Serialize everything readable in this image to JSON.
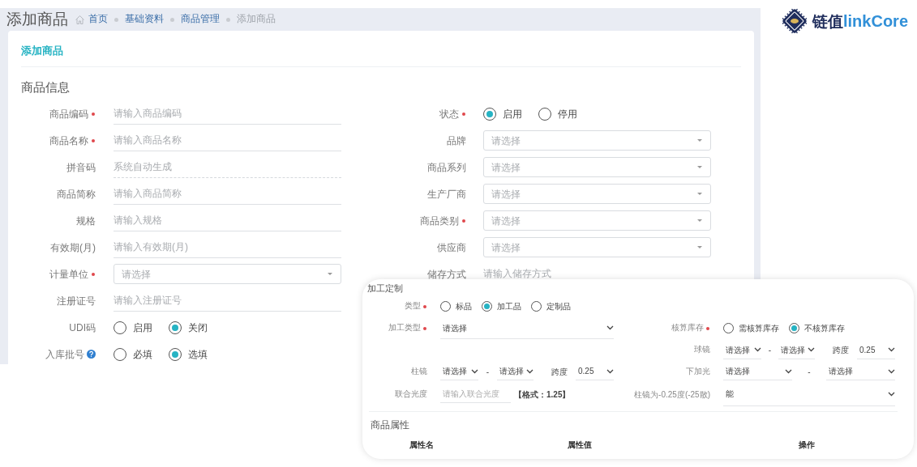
{
  "page": {
    "title": "添加商品",
    "breadcrumb": [
      {
        "label": "首页",
        "kind": "home",
        "current": false
      },
      {
        "label": "基础资料",
        "current": false
      },
      {
        "label": "商品管理",
        "current": false
      },
      {
        "label": "添加商品",
        "current": true
      }
    ]
  },
  "logo": {
    "name": "链值",
    "brand": "linkCore"
  },
  "card": {
    "title": "添加商品",
    "section": "商品信息"
  },
  "left_fields": [
    {
      "label": "商品编码",
      "required": true,
      "help": false,
      "kind": "text",
      "placeholder": "请输入商品编码"
    },
    {
      "label": "商品名称",
      "required": true,
      "help": false,
      "kind": "text",
      "placeholder": "请输入商品名称"
    },
    {
      "label": "拼音码",
      "required": false,
      "help": false,
      "kind": "readonly",
      "placeholder": "系统自动生成"
    },
    {
      "label": "商品简称",
      "required": false,
      "help": false,
      "kind": "text",
      "placeholder": "请输入商品简称"
    },
    {
      "label": "规格",
      "required": false,
      "help": false,
      "kind": "text",
      "placeholder": "请输入规格"
    },
    {
      "label": "有效期(月)",
      "required": false,
      "help": false,
      "kind": "text",
      "placeholder": "请输入有效期(月)"
    },
    {
      "label": "计量单位",
      "required": true,
      "help": false,
      "kind": "select",
      "placeholder": "请选择"
    },
    {
      "label": "注册证号",
      "required": false,
      "help": false,
      "kind": "text",
      "placeholder": "请输入注册证号"
    },
    {
      "label": "UDI码",
      "required": false,
      "help": false,
      "kind": "radio",
      "options": [
        {
          "label": "启用",
          "selected": false
        },
        {
          "label": "关闭",
          "selected": true
        }
      ]
    },
    {
      "label": "入库批号",
      "required": false,
      "help": true,
      "kind": "radio",
      "options": [
        {
          "label": "必填",
          "selected": false
        },
        {
          "label": "选填",
          "selected": true
        }
      ]
    }
  ],
  "right_fields": [
    {
      "label": "状态",
      "required": true,
      "help": false,
      "kind": "radio",
      "options": [
        {
          "label": "启用",
          "selected": true
        },
        {
          "label": "停用",
          "selected": false
        }
      ]
    },
    {
      "label": "品牌",
      "required": false,
      "help": false,
      "kind": "select",
      "placeholder": "请选择"
    },
    {
      "label": "商品系列",
      "required": false,
      "help": false,
      "kind": "select",
      "placeholder": "请选择"
    },
    {
      "label": "生产厂商",
      "required": false,
      "help": false,
      "kind": "select",
      "placeholder": "请选择"
    },
    {
      "label": "商品类别",
      "required": true,
      "help": false,
      "kind": "select",
      "placeholder": "请选择"
    },
    {
      "label": "供应商",
      "required": false,
      "help": false,
      "kind": "select",
      "placeholder": "请选择"
    },
    {
      "label": "储存方式",
      "required": false,
      "help": false,
      "kind": "text",
      "placeholder": "请输入储存方式"
    }
  ],
  "customization": {
    "title": "加工定制",
    "type": {
      "label": "类型",
      "required": true,
      "options": [
        {
          "label": "标品",
          "selected": false
        },
        {
          "label": "加工品",
          "selected": true
        },
        {
          "label": "定制品",
          "selected": false
        }
      ]
    },
    "process_type": {
      "label": "加工类型",
      "required": true,
      "value": "请选择"
    },
    "stock": {
      "label": "核算库存",
      "required": true,
      "options": [
        {
          "label": "需核算库存",
          "selected": false
        },
        {
          "label": "不核算库存",
          "selected": true
        }
      ]
    },
    "sphere": {
      "label": "球镜",
      "from": "请选择",
      "separator": "-",
      "to": "请选择",
      "span_label": "跨度",
      "span": "0.25"
    },
    "cylinder": {
      "label": "柱镜",
      "from": "请选择",
      "separator": "-",
      "to": "请选择",
      "span_label": "跨度",
      "span": "0.25"
    },
    "addition": {
      "label": "下加光",
      "from": "请选择",
      "separator": "-",
      "to": "请选择"
    },
    "combined_power": {
      "label": "联合光度",
      "placeholder": "请输入联合光度",
      "hint": "【格式：1.25】"
    },
    "cylinder_rule": {
      "label": "柱镜为-0.25度(-25散)",
      "value": "能"
    }
  },
  "attributes": {
    "title": "商品属性",
    "columns": [
      "属性名",
      "属性值",
      "操作"
    ]
  }
}
